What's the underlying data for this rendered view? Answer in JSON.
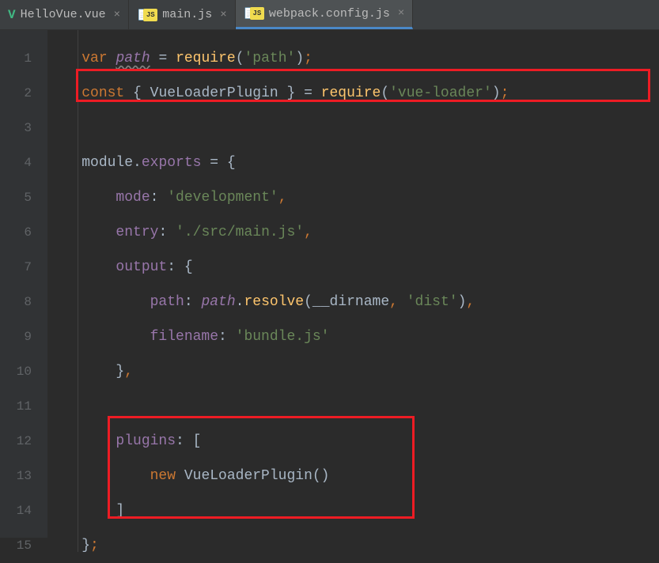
{
  "tabs": [
    {
      "label": "HelloVue.vue",
      "active": false,
      "icon": "vue"
    },
    {
      "label": "main.js",
      "active": false,
      "icon": "js"
    },
    {
      "label": "webpack.config.js",
      "active": true,
      "icon": "js"
    }
  ],
  "gutter": [
    "1",
    "2",
    "3",
    "4",
    "5",
    "6",
    "7",
    "8",
    "9",
    "10",
    "11",
    "12",
    "13",
    "14",
    "15"
  ],
  "code": {
    "l1": {
      "var": "var",
      "path": "path",
      "eq": " = ",
      "req": "require",
      "paren1": "(",
      "str": "'path'",
      "paren2": ")",
      "semi": ";"
    },
    "l2": {
      "const": "const",
      "brace1": " { ",
      "id": "VueLoaderPlugin",
      "brace2": " } ",
      "eq": "= ",
      "req": "require",
      "paren1": "(",
      "str": "'vue-loader'",
      "paren2": ")",
      "semi": ";"
    },
    "l4": {
      "mod": "module",
      "dot": ".",
      "exp": "exports",
      "eq": " = {"
    },
    "l5": {
      "prop": "mode",
      "colon": ": ",
      "str": "'development'",
      "comma": ","
    },
    "l6": {
      "prop": "entry",
      "colon": ": ",
      "str": "'./src/main.js'",
      "comma": ","
    },
    "l7": {
      "prop": "output",
      "colon": ": {"
    },
    "l8": {
      "prop": "path",
      "colon": ": ",
      "pathvar": "path",
      "dot": ".",
      "resolve": "resolve",
      "paren1": "(",
      "dirname": "__dirname",
      "comma1": ", ",
      "str": "'dist'",
      "paren2": ")",
      "comma2": ","
    },
    "l9": {
      "prop": "filename",
      "colon": ": ",
      "str": "'bundle.js'"
    },
    "l10": {
      "brace": "}",
      "comma": ","
    },
    "l12": {
      "prop": "plugins",
      "colon": ": ["
    },
    "l13": {
      "new": "new",
      "sp": " ",
      "id": "VueLoaderPlugin",
      "paren": "()"
    },
    "l14": {
      "bracket": "]"
    },
    "l15": {
      "brace": "}",
      "semi": ";"
    }
  }
}
